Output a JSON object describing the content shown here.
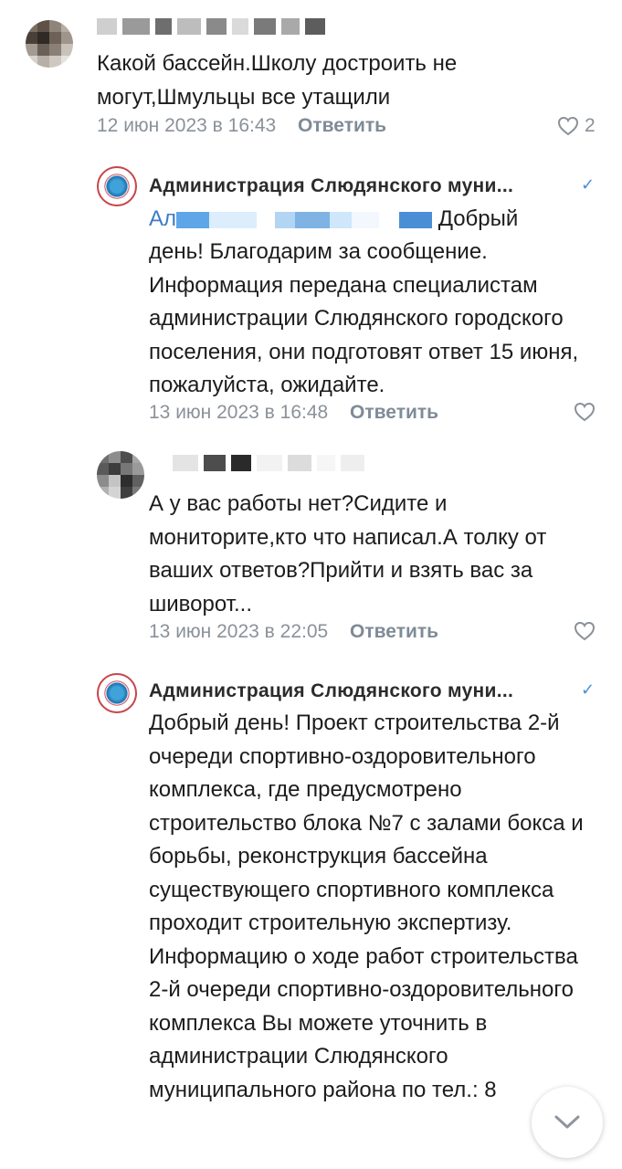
{
  "comments": [
    {
      "text": "Какой бассейн.Школу достроить не могут,Шмульцы все утащили",
      "date": "12 июн 2023 в 16:43",
      "reply_label": "Ответить",
      "likes": "2"
    },
    {
      "author": "Администрация Слюдянского муни...",
      "mention": "Ал",
      "text_tail": "Добрый",
      "text": "день! Благодарим за сообщение. Информация передана специалистам администрации Слюдянского городского поселения, они подготовят ответ 15 июня, пожалуйста, ожидайте.",
      "date": "13 июн 2023 в 16:48",
      "reply_label": "Ответить"
    },
    {
      "text": "А у вас работы нет?Сидите и мониторите,кто что написал.А толку от ваших ответов?Прийти и взять вас за шиворот...",
      "date": "13 июн 2023 в 22:05",
      "reply_label": "Ответить"
    },
    {
      "author": "Администрация Слюдянского муни...",
      "text": "Добрый день! Проект строительства 2-й очереди спортивно-оздоровительного комплекса, где предусмотрено строительство блока №7 с залами бокса и борьбы, реконструкция бассейна существующего спортивного комплекса проходит строительную экспертизу. Информацию о ходе работ строительства 2-й очереди спортивно-оздоровительного комплекса Вы можете уточнить в администрации Слюдянского муниципального района по тел.: 8"
    }
  ],
  "icons": {
    "like": "heart-icon",
    "verified": "check-icon",
    "scroll": "chevron-down-icon"
  },
  "colors": {
    "link": "#3f7bc9",
    "meta": "#8a9199",
    "verified": "#4a8dd8"
  }
}
